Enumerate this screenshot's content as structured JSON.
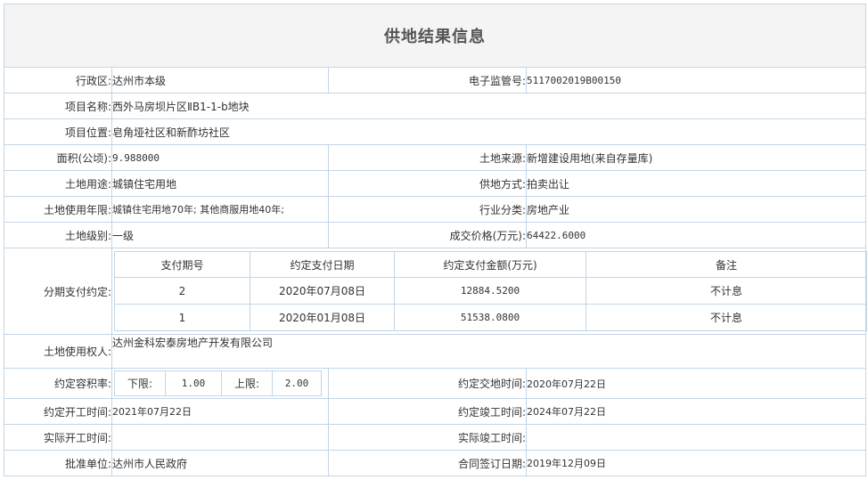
{
  "title": "供地结果信息",
  "fields": {
    "district_label": "行政区:",
    "district_value": "达州市本级",
    "supervision_no_label": "电子监管号:",
    "supervision_no_value": "5117002019B00150",
    "project_name_label": "项目名称:",
    "project_name_value": "西外马房坝片区ⅡB1-1-b地块",
    "project_location_label": "项目位置:",
    "project_location_value": "皂角垭社区和新酢坊社区",
    "area_label": "面积(公顷):",
    "area_value": "9.988000",
    "land_source_label": "土地来源:",
    "land_source_value": "新增建设用地(来自存量库)",
    "land_use_label": "土地用途:",
    "land_use_value": "城镇住宅用地",
    "supply_method_label": "供地方式:",
    "supply_method_value": "拍卖出让",
    "use_term_label": "土地使用年限:",
    "use_term_value": "城镇住宅用地70年; 其他商服用地40年;",
    "industry_label": "行业分类:",
    "industry_value": "房地产业",
    "land_grade_label": "土地级别:",
    "land_grade_value": "一级",
    "price_label": "成交价格(万元):",
    "price_value": "64422.6000",
    "installment_label": "分期支付约定:",
    "user_label": "土地使用权人:",
    "user_value": "达州金科宏泰房地产开发有限公司",
    "far_label": "约定容积率:",
    "far_lower_label": "下限:",
    "far_lower_value": "1.00",
    "far_upper_label": "上限:",
    "far_upper_value": "2.00",
    "delivery_label": "约定交地时间:",
    "delivery_value": "2020年07月22日",
    "start_agreed_label": "约定开工时间:",
    "start_agreed_value": "2021年07月22日",
    "finish_agreed_label": "约定竣工时间:",
    "finish_agreed_value": "2024年07月22日",
    "start_actual_label": "实际开工时间:",
    "start_actual_value": "",
    "finish_actual_label": "实际竣工时间:",
    "finish_actual_value": "",
    "approval_label": "批准单位:",
    "approval_value": "达州市人民政府",
    "contract_date_label": "合同签订日期:",
    "contract_date_value": "2019年12月09日"
  },
  "installments": {
    "headers": [
      "支付期号",
      "约定支付日期",
      "约定支付金额(万元)",
      "备注"
    ],
    "rows": [
      [
        "2",
        "2020年07月08日",
        "12884.5200",
        "不计息"
      ],
      [
        "1",
        "2020年01月08日",
        "51538.0800",
        "不计息"
      ]
    ]
  }
}
